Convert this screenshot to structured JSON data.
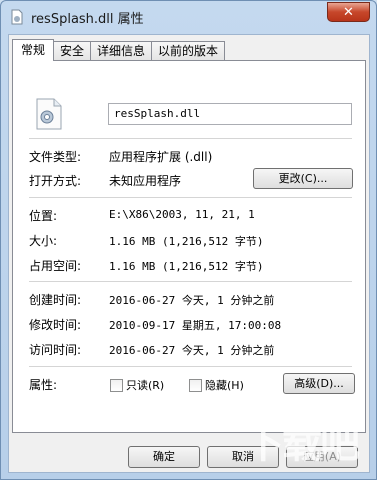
{
  "window": {
    "title": "resSplash.dll 属性"
  },
  "tabs": [
    {
      "label": "常规",
      "active": true
    },
    {
      "label": "安全",
      "active": false
    },
    {
      "label": "详细信息",
      "active": false
    },
    {
      "label": "以前的版本",
      "active": false
    }
  ],
  "general": {
    "filename": "resSplash.dll",
    "file_type_label": "文件类型:",
    "file_type_value": "应用程序扩展 (.dll)",
    "opens_with_label": "打开方式:",
    "opens_with_value": "未知应用程序",
    "change_button": "更改(C)...",
    "location_label": "位置:",
    "location_value": "E:\\X86\\2003, 11, 21, 1",
    "size_label": "大小:",
    "size_value": "1.16 MB (1,216,512 字节)",
    "disk_size_label": "占用空间:",
    "disk_size_value": "1.16 MB (1,216,512 字节)",
    "created_label": "创建时间:",
    "created_value": "2016-06-27 今天, 1 分钟之前",
    "modified_label": "修改时间:",
    "modified_value": "2010-09-17 星期五, 17:00:08",
    "accessed_label": "访问时间:",
    "accessed_value": "2016-06-27 今天, 1 分钟之前",
    "attributes_label": "属性:",
    "readonly_label": "只读(R)",
    "hidden_label": "隐藏(H)",
    "advanced_button": "高级(D)..."
  },
  "footer": {
    "ok_button": "确定",
    "cancel_button": "取消",
    "apply_button": "应用(A)"
  },
  "watermark": "下载吧"
}
